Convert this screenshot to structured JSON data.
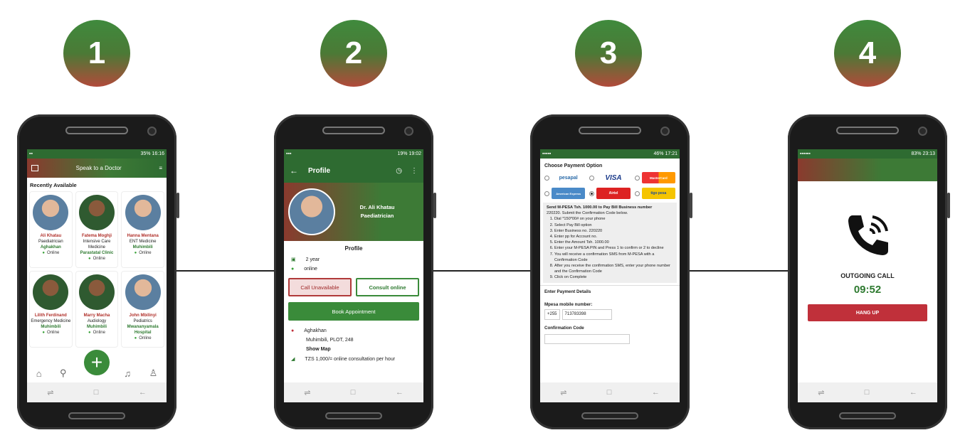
{
  "steps": [
    "1",
    "2",
    "3",
    "4"
  ],
  "screen1": {
    "status": "16:16",
    "battery": "35%",
    "header": "Speak to a Doctor",
    "section": "Recently Available",
    "doctors": [
      {
        "name": "Ali Khatau",
        "spec": "Paediatrician",
        "hosp": "Aghakhan",
        "status": "Online"
      },
      {
        "name": "Fatema Moghji",
        "spec": "Intensive Care Medicine",
        "hosp": "Parastatal Clinic",
        "status": "Online"
      },
      {
        "name": "Hanna Mentana",
        "spec": "ENT Medicine",
        "hosp": "Muhimbili",
        "status": "Online"
      },
      {
        "name": "Lilith Ferdinand",
        "spec": "Emergency Medicine",
        "hosp": "Muhimbili",
        "status": "Online"
      },
      {
        "name": "Marry Macha",
        "spec": "Audiology",
        "hosp": "Muhimbili",
        "status": "Online"
      },
      {
        "name": "John Mbilinyi",
        "spec": "Pediatrics",
        "hosp": "Mwananyamala Hospital",
        "status": "Online"
      }
    ],
    "fab": "+"
  },
  "screen2": {
    "status": "19:02",
    "battery": "19%",
    "title": "Profile",
    "doctor": "Dr. Ali Khatau",
    "spec": "Paediatrician",
    "section": "Profile",
    "experience": "2 year",
    "online": "online",
    "call": "Call Unavailable",
    "consult": "Consult online",
    "book": "Book Appointment",
    "hospital": "Aghakhan",
    "address": "Muhimbili, PLOT, 248",
    "map": "Show Map",
    "fee": "TZS 1,000/= online consultation per hour"
  },
  "screen3": {
    "status": "17:21",
    "battery": "46%",
    "title": "Choose Payment Option",
    "methods": [
      "pesapal",
      "VISA",
      "MasterCard",
      "American Express",
      "Airtel",
      "tigo pesa"
    ],
    "intro1": "Send M-PESA Tsh. 1000.00 to Pay Bill Business number",
    "intro2": "220220. Submit the Confirmation Code below.",
    "steps": [
      "Dial *150*00# on your phone",
      "Select Pay Bill option",
      "Enter Business no. 220220",
      "Enter pp for Account no.",
      "Enter the Amount Tsh. 1000.00",
      "Enter your M-PESA PIN and Press 1 to confirm or 2 to decline",
      "You will receive a confirmation SMS from M-PESA with a Confirmation Code",
      "After you receive the confirmation SMS, enter your phone number and the Confirmation Code",
      "Click on Complete"
    ],
    "details": "Enter Payment Details",
    "mobile_label": "Mpesa mobile number:",
    "prefix": "+255",
    "mobile": "713783398",
    "code_label": "Confirmation Code"
  },
  "screen4": {
    "status": "23:13",
    "battery": "83%",
    "label": "OUTGOING CALL",
    "time": "09:52",
    "hang": "HANG UP"
  }
}
